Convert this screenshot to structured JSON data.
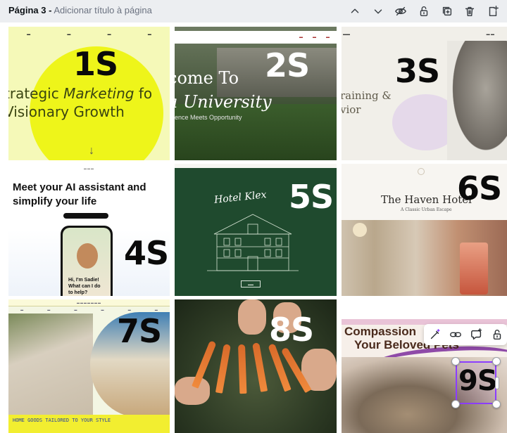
{
  "header": {
    "page_number": "Página 3 -",
    "add_title": "Adicionar título à página",
    "icons": [
      "chevron-up-icon",
      "chevron-down-icon",
      "hide-icon",
      "lock-icon",
      "duplicate-icon",
      "trash-icon",
      "add-page-icon"
    ]
  },
  "tiles": [
    {
      "label": "1S",
      "headline_1": "trategic ",
      "headline_em": "Marketing",
      "headline_2": " fo",
      "headline_3": "Visionary Growth"
    },
    {
      "label": "2S",
      "headline_1": "come To",
      "headline_2": "a University",
      "sub": "ence Meets Opportunity"
    },
    {
      "label": "3S",
      "headline_1": "raining &",
      "headline_2": "vior"
    },
    {
      "label": "4S",
      "headline_1": "Meet your AI assistant and",
      "headline_2": "simplify your life",
      "bubble_1": "Hi, I'm Sadie!",
      "bubble_2": "What can I do",
      "bubble_3": "to help?"
    },
    {
      "label": "5S",
      "headline": "Hotel Klex"
    },
    {
      "label": "6S",
      "headline": "The Haven Hotel",
      "sub": "A Classic Urban Escape"
    },
    {
      "label": "7S",
      "bottom_line": "HOME GOODS TAILORED TO YOUR STYLE"
    },
    {
      "label": "8S"
    },
    {
      "label": "9S",
      "headline_1": "Compassion",
      "headline_2": "Your Beloved Pets"
    }
  ],
  "colors": {
    "selection": "#8b3dff",
    "topbar_bg": "#eceef1"
  },
  "mini_toolbar": {
    "icons": [
      "magic-edit-icon",
      "link-icon",
      "comment-icon",
      "lock-icon"
    ]
  }
}
